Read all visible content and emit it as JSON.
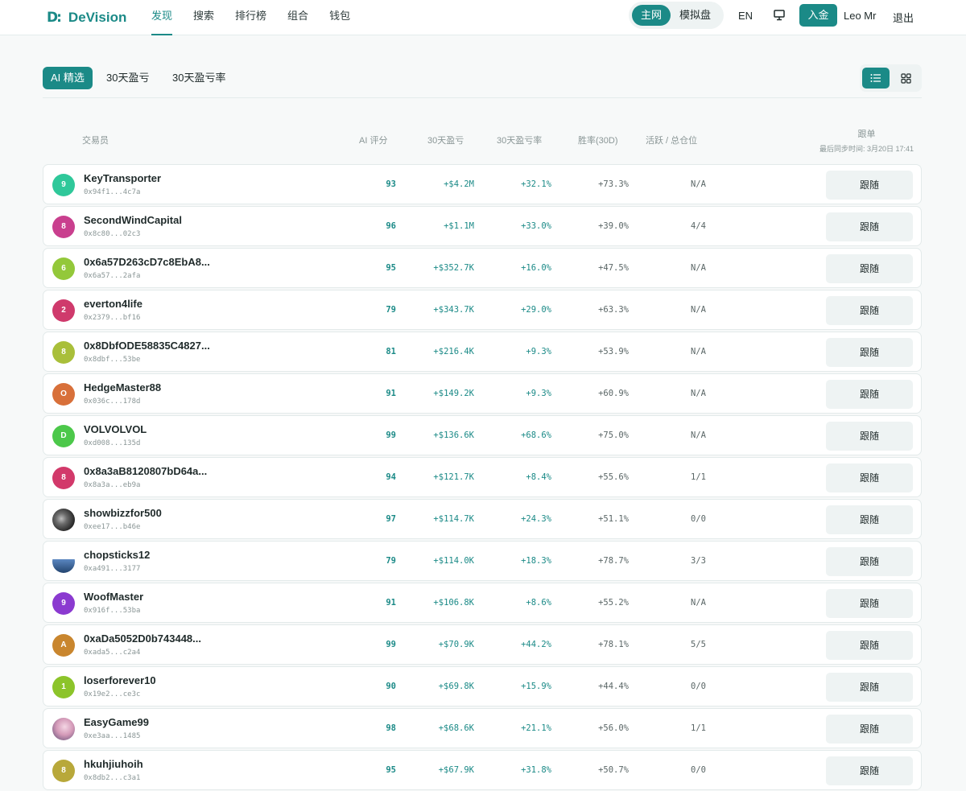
{
  "header": {
    "logo_mark": "D:",
    "logo_text": "DeVision",
    "nav": [
      "发现",
      "搜索",
      "排行榜",
      "组合",
      "钱包"
    ],
    "network": {
      "mainnet": "主网",
      "simulation": "模拟盘"
    },
    "lang": "EN",
    "deposit": "入金",
    "user": "Leo Mr",
    "logout": "退出",
    "accent": "#1b8a87"
  },
  "filters": {
    "tabs": [
      "AI 精选",
      "30天盈亏",
      "30天盈亏率"
    ],
    "active_tab": "AI 精选",
    "view_list_icon": "list-icon",
    "view_grid_icon": "grid-icon"
  },
  "table": {
    "headers": {
      "trader": "交易员",
      "ai_score": "AI 评分",
      "pnl_30d": "30天盈亏",
      "pnl_rate_30d": "30天盈亏率",
      "win_rate": "胜率(30D)",
      "active_total": "活跃 / 总仓位",
      "follow": "跟单",
      "sync": "最后同步时间: 3月20日 17:41"
    },
    "follow_label": "跟随",
    "rows": [
      {
        "name": "KeyTransporter",
        "addr": "0x94f1...4c7a",
        "initial": "9",
        "color": "#2fc89a",
        "ai": "93",
        "pnl": "+$4.2M",
        "rate": "+32.1%",
        "win": "+73.3%",
        "active": "N/A"
      },
      {
        "name": "SecondWindCapital",
        "addr": "0x8c80...02c3",
        "initial": "8",
        "color": "#c93f8e",
        "ai": "96",
        "pnl": "+$1.1M",
        "rate": "+33.0%",
        "win": "+39.0%",
        "active": "4/4"
      },
      {
        "name": "0x6a57D263cD7c8EbA8...",
        "addr": "0x6a57...2afa",
        "initial": "6",
        "color": "#93c83a",
        "ai": "95",
        "pnl": "+$352.7K",
        "rate": "+16.0%",
        "win": "+47.5%",
        "active": "N/A"
      },
      {
        "name": "everton4life",
        "addr": "0x2379...bf16",
        "initial": "2",
        "color": "#cf3a6c",
        "ai": "79",
        "pnl": "+$343.7K",
        "rate": "+29.0%",
        "win": "+63.3%",
        "active": "N/A"
      },
      {
        "name": "0x8DbfODE58835C4827...",
        "addr": "0x8dbf...53be",
        "initial": "8",
        "color": "#a9bf3a",
        "ai": "81",
        "pnl": "+$216.4K",
        "rate": "+9.3%",
        "win": "+53.9%",
        "active": "N/A"
      },
      {
        "name": "HedgeMaster88",
        "addr": "0x036c...178d",
        "initial": "O",
        "color": "#d8703a",
        "ai": "91",
        "pnl": "+$149.2K",
        "rate": "+9.3%",
        "win": "+60.9%",
        "active": "N/A"
      },
      {
        "name": "VOLVOLVOL",
        "addr": "0xd008...135d",
        "initial": "D",
        "color": "#4cc84a",
        "ai": "99",
        "pnl": "+$136.6K",
        "rate": "+68.6%",
        "win": "+75.0%",
        "active": "N/A"
      },
      {
        "name": "0x8a3aB8120807bD64a...",
        "addr": "0x8a3a...eb9a",
        "initial": "8",
        "color": "#d2396a",
        "ai": "94",
        "pnl": "+$121.7K",
        "rate": "+8.4%",
        "win": "+55.6%",
        "active": "1/1"
      },
      {
        "name": "showbizzfor500",
        "addr": "0xee17...b46e",
        "initial": "",
        "color": "#555555",
        "photo": "dark",
        "ai": "97",
        "pnl": "+$114.7K",
        "rate": "+24.3%",
        "win": "+51.1%",
        "active": "0/0"
      },
      {
        "name": "chopsticks12",
        "addr": "0xa491...3177",
        "initial": "",
        "color": "#3a6aa8",
        "photo": "blue",
        "ai": "79",
        "pnl": "+$114.0K",
        "rate": "+18.3%",
        "win": "+78.7%",
        "active": "3/3"
      },
      {
        "name": "WoofMaster",
        "addr": "0x916f...53ba",
        "initial": "9",
        "color": "#8b3ad0",
        "ai": "91",
        "pnl": "+$106.8K",
        "rate": "+8.6%",
        "win": "+55.2%",
        "active": "N/A"
      },
      {
        "name": "0xaDa5052D0b743448...",
        "addr": "0xada5...c2a4",
        "initial": "A",
        "color": "#c9862e",
        "ai": "99",
        "pnl": "+$70.9K",
        "rate": "+44.2%",
        "win": "+78.1%",
        "active": "5/5"
      },
      {
        "name": "loserforever10",
        "addr": "0x19e2...ce3c",
        "initial": "1",
        "color": "#8cc42a",
        "ai": "90",
        "pnl": "+$69.8K",
        "rate": "+15.9%",
        "win": "+44.4%",
        "active": "0/0"
      },
      {
        "name": "EasyGame99",
        "addr": "0xe3aa...1485",
        "initial": "",
        "color": "#c98aa8",
        "photo": "pink",
        "ai": "98",
        "pnl": "+$68.6K",
        "rate": "+21.1%",
        "win": "+56.0%",
        "active": "1/1"
      },
      {
        "name": "hkuhjiuhoih",
        "addr": "0x8db2...c3a1",
        "initial": "8",
        "color": "#b8a83a",
        "ai": "95",
        "pnl": "+$67.9K",
        "rate": "+31.8%",
        "win": "+50.7%",
        "active": "0/0"
      }
    ]
  }
}
